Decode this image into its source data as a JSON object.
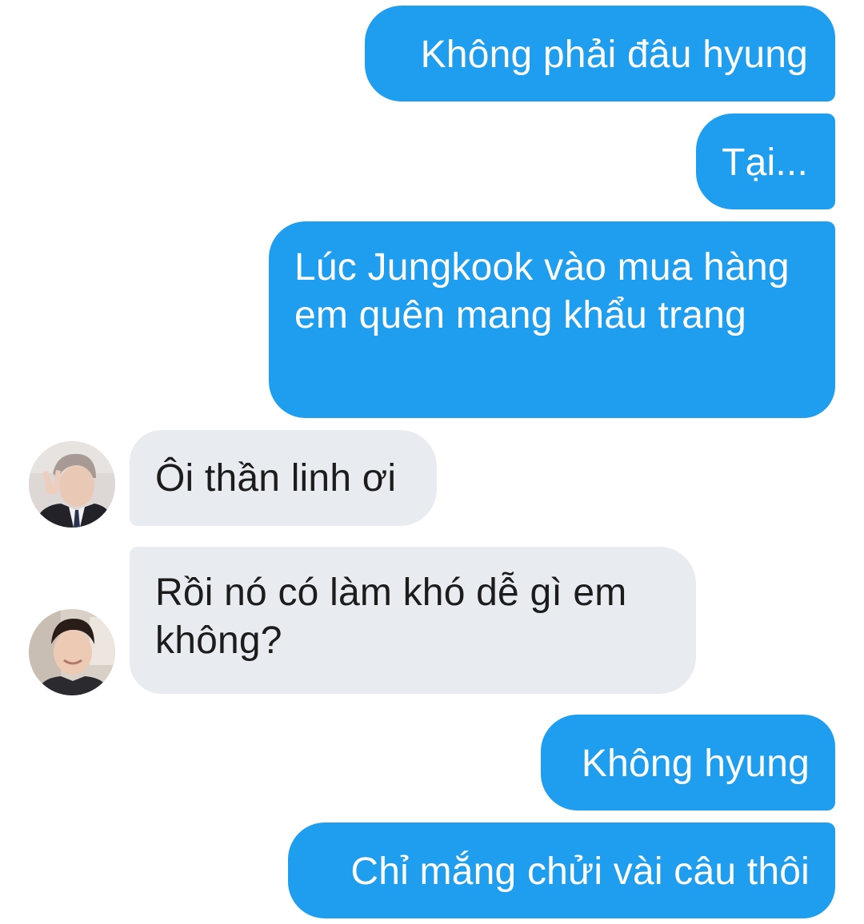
{
  "messages": [
    {
      "direction": "outgoing",
      "text": "Không phải đâu hyung"
    },
    {
      "direction": "outgoing",
      "text": "Tại..."
    },
    {
      "direction": "outgoing",
      "text": "Lúc Jungkook vào mua hàng em quên mang khẩu trang"
    },
    {
      "direction": "incoming",
      "text": "Ôi thần linh ơi",
      "avatar": "avatar-photo-icon"
    },
    {
      "direction": "incoming",
      "text": "Rồi nó có làm khó dễ gì em không?",
      "avatar": "avatar-photo-icon"
    },
    {
      "direction": "outgoing",
      "text": "Không hyung"
    },
    {
      "direction": "outgoing",
      "text": "Chỉ mắng chửi vài câu thôi"
    }
  ],
  "colors": {
    "outgoing_bubble": "#1f9ef0",
    "incoming_bubble": "#e8ebef",
    "outgoing_text": "#ffffff",
    "incoming_text": "#1c1c1c"
  }
}
